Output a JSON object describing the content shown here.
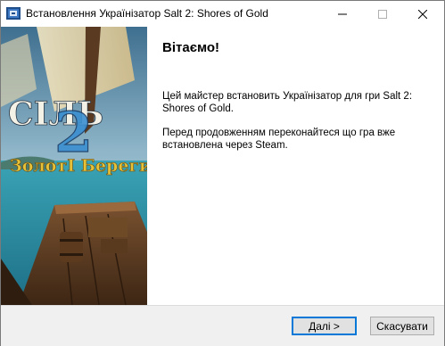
{
  "window": {
    "title": "Встановлення Українізатор Salt 2: Shores of Gold",
    "icons": {
      "app": "installer-icon",
      "minimize": "minimize-icon",
      "maximize": "maximize-icon",
      "close": "close-icon"
    }
  },
  "banner": {
    "title_line1": "СІЛЬ",
    "title_number": "2",
    "title_line2": "ЗолотІ Береги"
  },
  "content": {
    "heading": "Вітаємо!",
    "paragraph1": "Цей майстер встановить Українізатор для гри Salt 2: Shores of Gold.",
    "paragraph2": "Перед продовженням переконайтеся що гра вже встановлена через Steam."
  },
  "footer": {
    "next_label": "Далі >",
    "cancel_label": "Скасувати"
  },
  "colors": {
    "accent": "#0078d7",
    "footer_bg": "#f0f0f0",
    "banner_title": "#e6c23a"
  }
}
